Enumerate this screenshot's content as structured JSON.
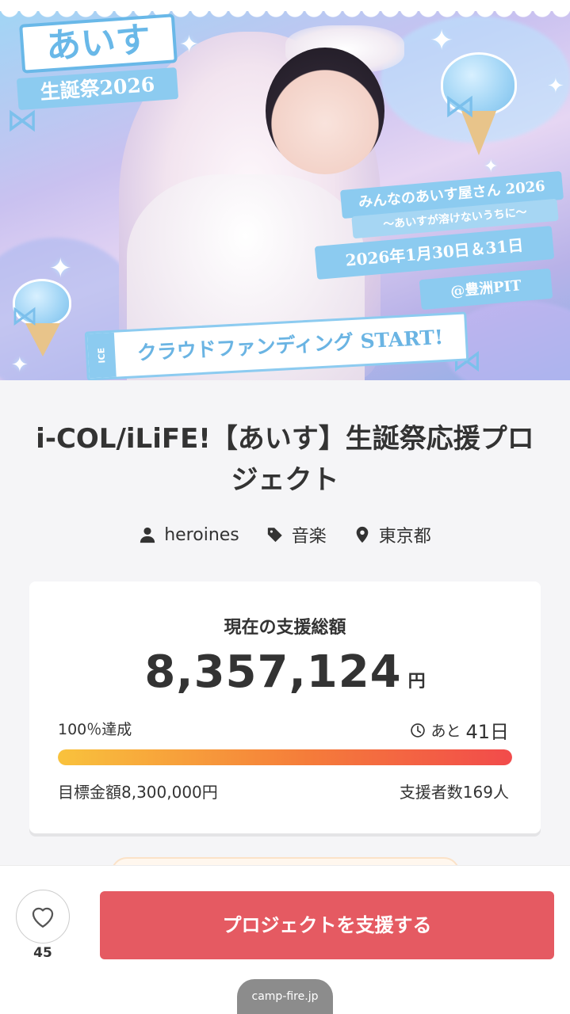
{
  "hero": {
    "title": "あいす",
    "subtitle": "生誕祭2026",
    "event_name": "みんなのあいす屋さん 2026",
    "event_tagline": "～あいすが溶けないうちに～",
    "event_date": "2026年1月30日＆31日",
    "event_venue": "@豊洲PIT",
    "ice_label": "ICE",
    "cf_label": "クラウドファンディング START!",
    "theme_color": "#8ccbf0"
  },
  "project": {
    "title": "i-COL/iLiFE!【あいす】生誕祭応援プロジェクト",
    "owner": "heroines",
    "category": "音楽",
    "location": "東京都"
  },
  "funding": {
    "label": "現在の支援総額",
    "amount": "8,357,124",
    "unit": "円",
    "achieved": "100％達成",
    "remaining_prefix": "あと",
    "remaining_days": "41日",
    "goal": "目標金額8,300,000円",
    "supporters": "支援者数169人",
    "progress_percent": 100,
    "progress_colors": [
      "#f9c23c",
      "#f57c3a",
      "#f24b4b"
    ]
  },
  "actions": {
    "like_count": "45",
    "support_label": "プロジェクトを支援する",
    "support_color": "#e55a62"
  },
  "browser": {
    "url": "camp-fire.jp"
  },
  "icons": [
    "user-icon",
    "tag-icon",
    "location-pin-icon",
    "clock-icon",
    "heart-icon"
  ]
}
